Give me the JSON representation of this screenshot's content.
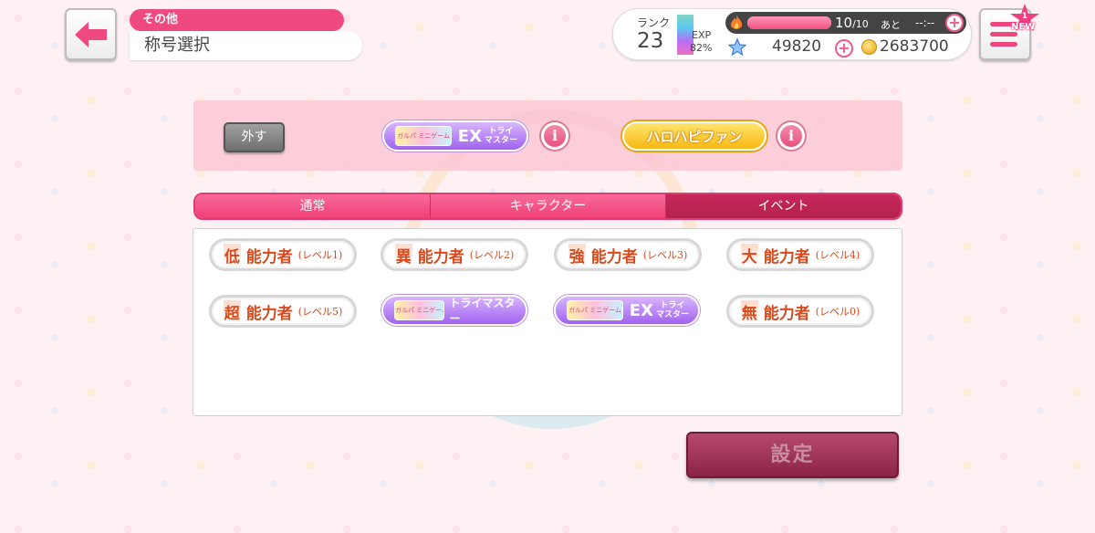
{
  "header": {
    "category": "その他",
    "title": "称号選択"
  },
  "status": {
    "rank_label": "ランク",
    "rank": "23",
    "exp_label": "EXP",
    "exp_percent": "82%",
    "stamina_current": "10",
    "stamina_max": "/10",
    "stamina_fill_fraction": 1.0,
    "stamina_next_label": "あと",
    "stamina_timer": "--:--",
    "gems": "49820",
    "coins": "2683700",
    "menu_badge": "NEW",
    "menu_badge_count": "1"
  },
  "equipped": {
    "remove_label": "外す",
    "slot1": {
      "logo": "ガルパ ミニゲーム",
      "ex": "EX",
      "line1": "トライ",
      "line2": "マスター"
    },
    "slot2": {
      "label": "ハロハピファン"
    }
  },
  "tabs": [
    {
      "label": "通常"
    },
    {
      "label": "キャラクター"
    },
    {
      "label": "イベント"
    }
  ],
  "titles": [
    {
      "k1": "低",
      "k2": "能力者",
      "level": "(レベル1)"
    },
    {
      "k1": "異",
      "k2": "能力者",
      "level": "(レベル2)"
    },
    {
      "k1": "強",
      "k2": "能力者",
      "level": "(レベル3)"
    },
    {
      "k1": "大",
      "k2": "能力者",
      "level": "(レベル4)"
    },
    {
      "k1": "超",
      "k2": "能力者",
      "level": "(レベル5)"
    },
    {
      "logo": "ガルパ ミニゲーム",
      "label": "トライマスター"
    },
    {
      "logo": "ガルパ ミニゲーム",
      "ex": "EX",
      "line1": "トライ",
      "line2": "マスター"
    },
    {
      "k1": "無",
      "k2": "能力者",
      "level": "(レベル0)"
    }
  ],
  "confirm_label": "設定"
}
